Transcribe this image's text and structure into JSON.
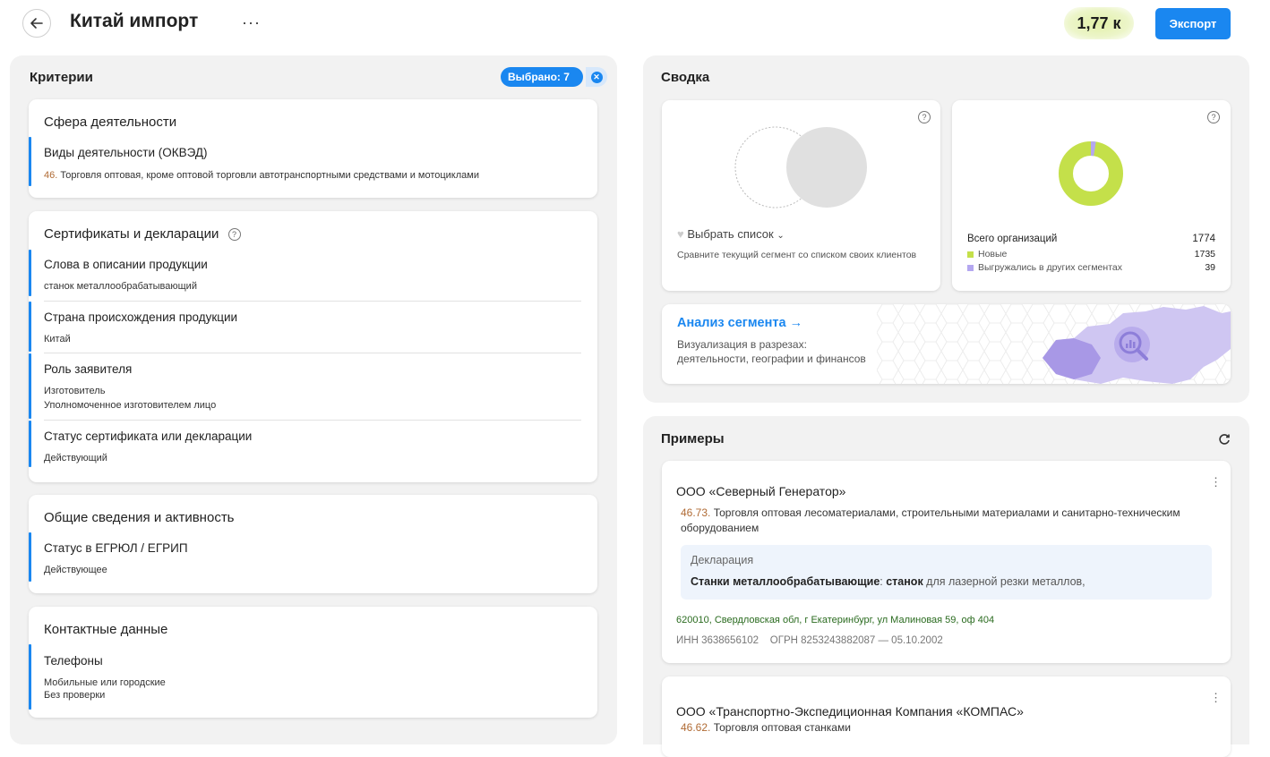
{
  "header": {
    "title": "Китай импорт",
    "more": "···",
    "count": "1,77 к",
    "export_label": "Экспорт"
  },
  "criteria": {
    "title": "Критерии",
    "selected_badge": "Выбрано: 7",
    "groups": {
      "activity": {
        "title": "Сфера деятельности",
        "okved_name": "Виды деятельности (ОКВЭД)",
        "okved_code": "46.",
        "okved_text": " Торговля оптовая, кроме оптовой торговли автотранспортными средствами и мотоциклами"
      },
      "certs": {
        "title": "Сертификаты и декларации",
        "items": [
          {
            "name": "Слова в описании продукции",
            "value": "станок металлообрабатывающий"
          },
          {
            "name": "Страна происхождения продукции",
            "value": "Китай"
          },
          {
            "name": "Роль заявителя",
            "value": "Изготовитель",
            "value2": "Уполномоченное изготовителем лицо"
          },
          {
            "name": "Статус сертификата или декларации",
            "value": "Действующий"
          }
        ]
      },
      "general": {
        "title": "Общие сведения и активность",
        "name": "Статус в ЕГРЮЛ / ЕГРИП",
        "value": "Действующее"
      },
      "contacts": {
        "title": "Контактные данные",
        "name": "Телефоны",
        "value": "Мобильные или городские",
        "value2": "Без проверки"
      }
    }
  },
  "summary": {
    "title": "Сводка",
    "compare": {
      "select_list": "Выбрать список",
      "description": "Сравните текущий сегмент со списком своих клиентов"
    },
    "orgs": {
      "total_label": "Всего организаций",
      "total_value": "1774",
      "new_label": "Новые",
      "new_value": "1735",
      "other_label": "Выгружались в других сегментах",
      "other_value": "39",
      "colors": {
        "new": "#c4e04a",
        "other": "#b4a7f0"
      }
    },
    "analysis": {
      "title": "Анализ сегмента →",
      "line1": "Визуализация в разрезах:",
      "line2": "деятельности, географии и финансов"
    }
  },
  "examples": {
    "title": "Примеры",
    "items": [
      {
        "company": "ООО «Северный Генератор»",
        "code": "46.73.",
        "activity": " Торговля оптовая лесоматериалами, строительными материалами и санитарно-техническим оборудованием",
        "decl_label": "Декларация",
        "decl_bold1": "Станки металлообрабатывающие",
        "decl_colon": ": ",
        "decl_bold2": "станок",
        "decl_rest": " для лазерной резки металлов,",
        "address": "620010, Свердловская обл, г Екатеринбург, ул Малиновая 59, оф 404",
        "ids": "ИНН 3638656102    ОГРН 8253243882087 — 05.10.2002"
      },
      {
        "company": "ООО «Транспортно-Экспедиционная Компания «КОМПАС»",
        "code": "46.62.",
        "activity": " Торговля оптовая станками"
      }
    ]
  }
}
